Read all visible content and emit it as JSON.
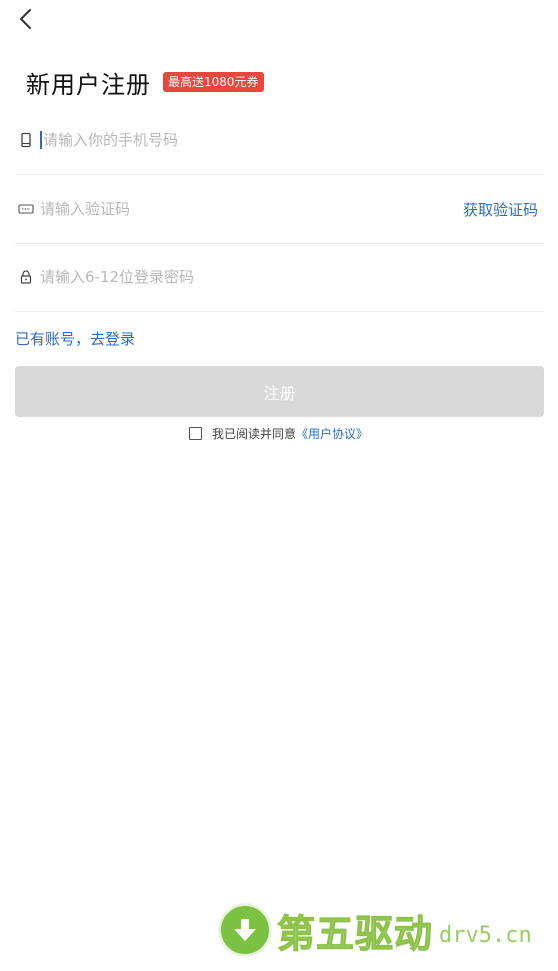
{
  "header": {
    "back_icon": "back-arrow-icon",
    "title": "新用户注册",
    "promo_badge": "最高送1080元券"
  },
  "form": {
    "phone": {
      "icon": "phone-icon",
      "placeholder": "请输入你的手机号码",
      "value": ""
    },
    "code": {
      "icon": "sms-code-icon",
      "placeholder": "请输入验证码",
      "value": "",
      "get_code_label": "获取验证码"
    },
    "password": {
      "icon": "lock-icon",
      "placeholder": "请输入6-12位登录密码",
      "value": ""
    }
  },
  "login_link": "已有账号，去登录",
  "register_button": "注册",
  "agreement": {
    "checked": false,
    "text": "我已阅读并同意",
    "link": "《用户协议》"
  },
  "watermark": {
    "name": "第五驱动",
    "domain": "drv5.cn"
  },
  "colors": {
    "accent": "#2c6ec5",
    "promo": "#e8473d",
    "button_disabled": "#d9d9d9",
    "watermark_green": "#7cc242"
  }
}
